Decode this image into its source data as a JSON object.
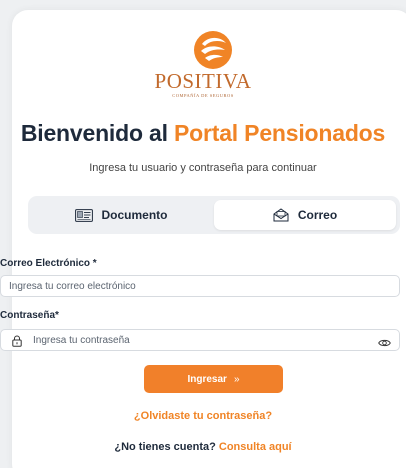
{
  "brand": {
    "logo_name": "POSITIVA",
    "logo_tagline": "COMPAÑÍA DE SEGUROS",
    "primary_color": "#f08426",
    "dark_color": "#1e2a3b"
  },
  "header": {
    "title_prefix": "Bienvenido al",
    "title_accent": "Portal Pensionados",
    "subtitle": "Ingresa tu usuario y contraseña para continuar"
  },
  "tabs": [
    {
      "label": "Documento",
      "icon": "id-card-icon",
      "active": false
    },
    {
      "label": "Correo",
      "icon": "envelope-icon",
      "active": true
    }
  ],
  "form": {
    "email_label": "Correo Electrónico *",
    "email_placeholder": "Ingresa tu correo electrónico",
    "email_value": "",
    "password_label": "Contraseña*",
    "password_placeholder": "Ingresa tu contraseña",
    "password_value": "",
    "submit_label": "Ingresar",
    "submit_arrow": "»"
  },
  "links": {
    "forgot_password": "¿Olvidaste tu contraseña?",
    "no_account": "¿No tienes cuenta?",
    "consult": "Consulta aquí"
  }
}
